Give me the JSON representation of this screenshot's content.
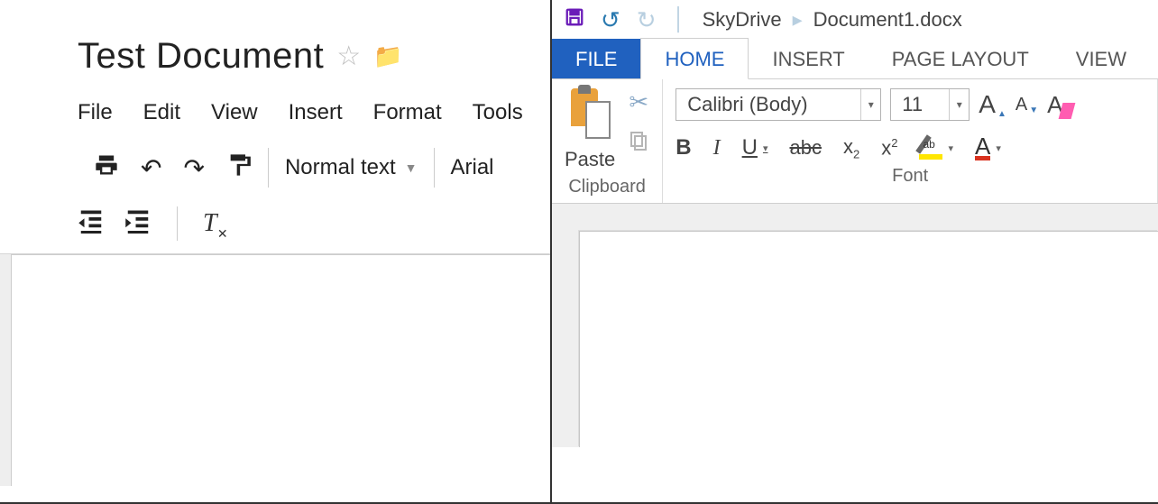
{
  "gdocs": {
    "title": "Test Document",
    "menu": [
      "File",
      "Edit",
      "View",
      "Insert",
      "Format",
      "Tools"
    ],
    "toolbar": {
      "paragraph_style": "Normal text",
      "font_family": "Arial"
    }
  },
  "word": {
    "quick_access": {
      "breadcrumb_root": "SkyDrive",
      "breadcrumb_file": "Document1.docx"
    },
    "tabs": {
      "file": "FILE",
      "home": "HOME",
      "insert": "INSERT",
      "page_layout": "PAGE LAYOUT",
      "view": "VIEW",
      "active": "HOME"
    },
    "ribbon": {
      "clipboard": {
        "label": "Clipboard",
        "paste": "Paste"
      },
      "font": {
        "label": "Font",
        "family": "Calibri (Body)",
        "size": "11"
      }
    }
  }
}
